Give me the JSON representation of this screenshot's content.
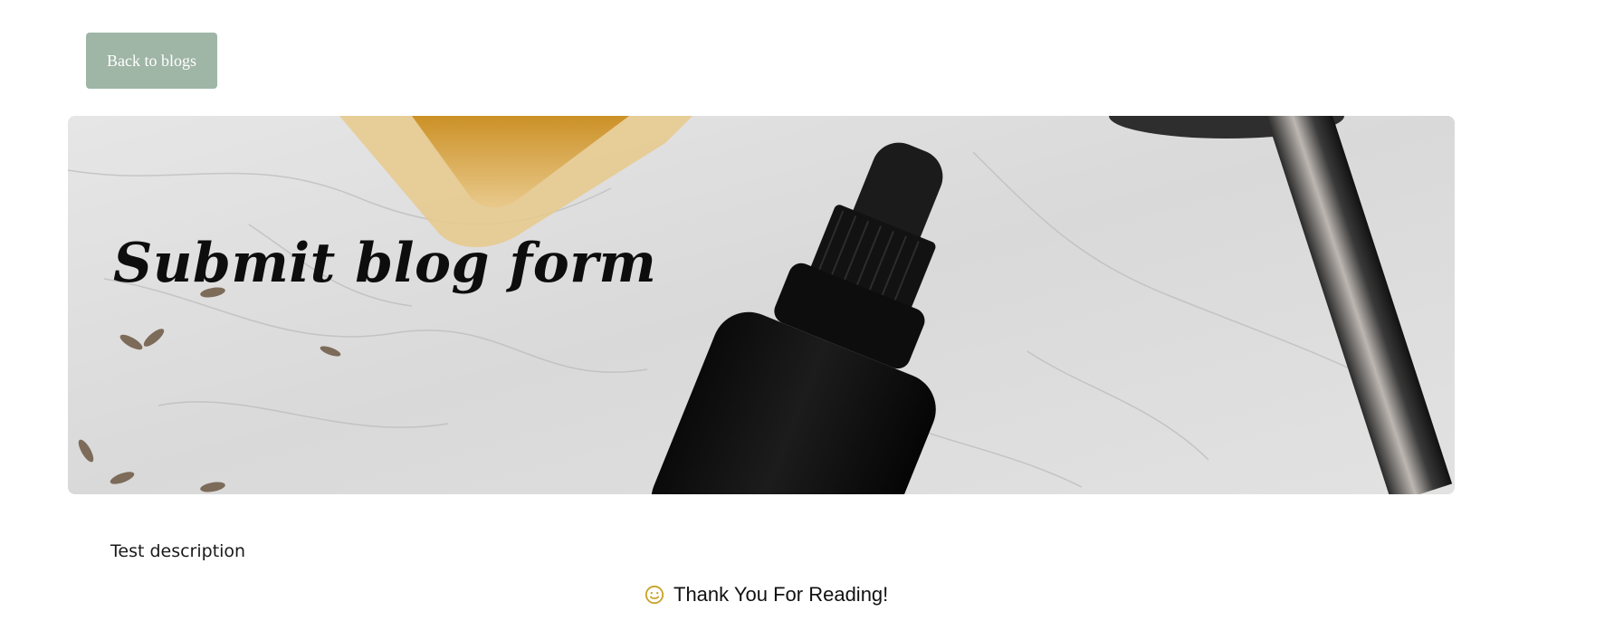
{
  "navigation": {
    "back_label": "Back to blogs"
  },
  "hero": {
    "title": "Submit blog form",
    "image_icon": "hero-photo"
  },
  "content": {
    "description": "Test description",
    "thanks_text": "Thank You For Reading!",
    "thanks_icon": "smiley-icon"
  },
  "colors": {
    "button_bg": "#9fb5a6",
    "button_text": "#ffffff",
    "smiley": "#c9a227"
  }
}
